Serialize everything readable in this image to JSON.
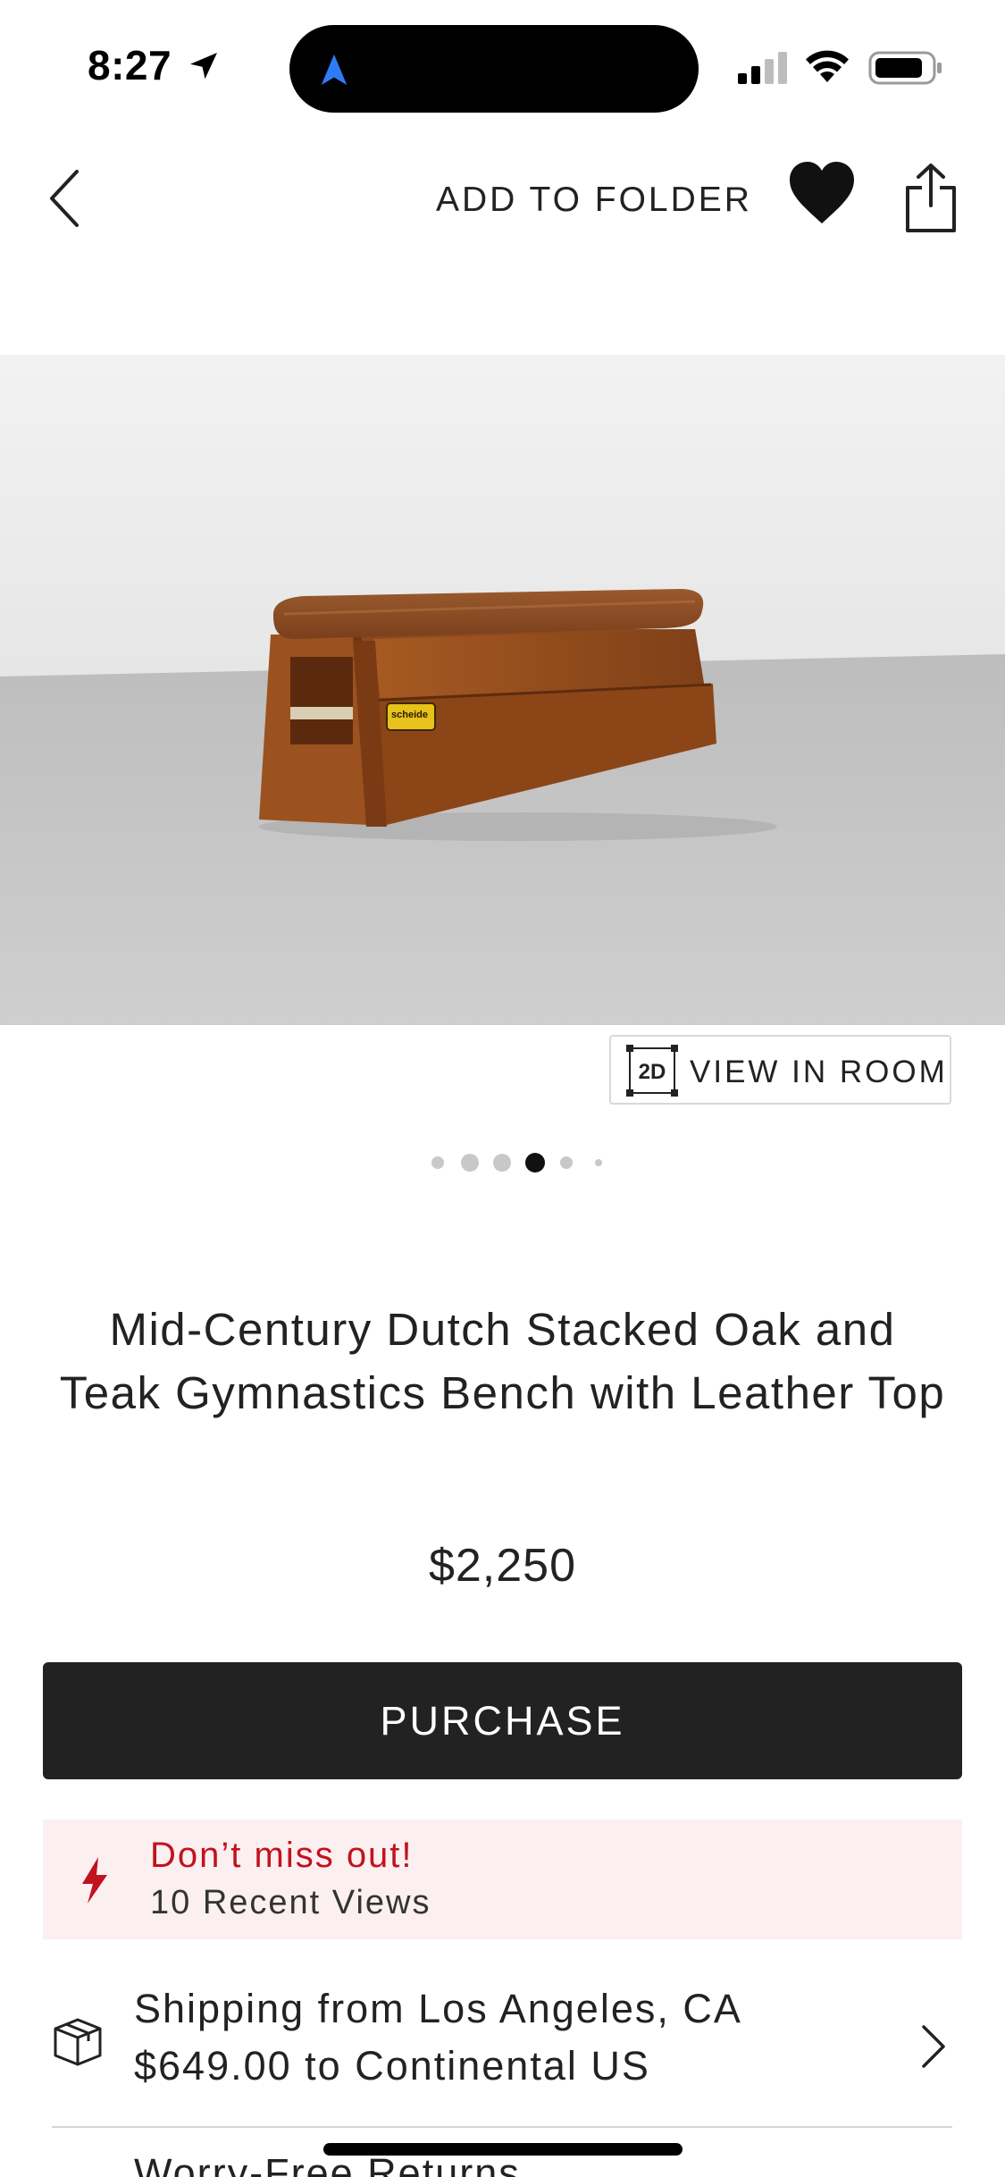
{
  "status_bar": {
    "time": "8:27"
  },
  "header": {
    "add_to_folder": "ADD TO FOLDER"
  },
  "gallery": {
    "view_in_room": "VIEW IN ROOM",
    "view_in_room_icon_text": "2D",
    "total_images": 6,
    "active_index": 3,
    "label_text": "scheide"
  },
  "product": {
    "title": "Mid-Century Dutch Stacked Oak and Teak Gymnastics Bench with Leather Top",
    "price": "$2,250",
    "purchase_label": "PURCHASE"
  },
  "alert": {
    "title": "Don’t miss out!",
    "subtitle": "10 Recent Views"
  },
  "shipping": {
    "title": "Shipping from Los Angeles, CA",
    "subtitle": "$649.00 to Continental US"
  },
  "next_row": {
    "label": "Worry-Free Returns"
  },
  "colors": {
    "accent_red": "#c1121f",
    "alert_bg": "#fcefef",
    "button_dark": "#222222",
    "island_nav_blue": "#2f7bf5"
  }
}
